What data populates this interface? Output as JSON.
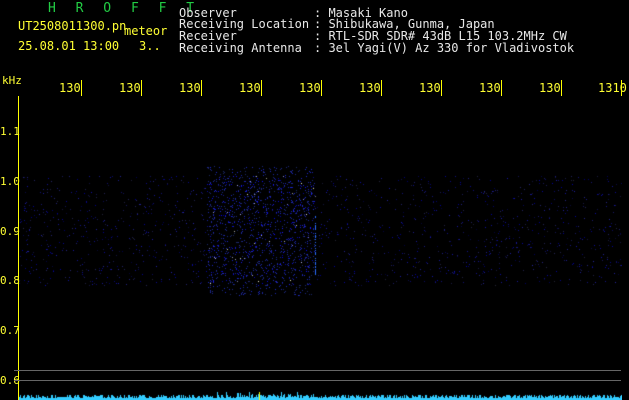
{
  "header": {
    "title": "H R O F F T",
    "file_name": "UT2508011300.pn",
    "meteor_label": "meteor",
    "datetime": "25.08.01 13:00",
    "count": "3.."
  },
  "info": [
    {
      "label": "Observer",
      "value": ": Masaki Kano"
    },
    {
      "label": "Receiving Location",
      "value": ": Shibukawa, Gunma, Japan"
    },
    {
      "label": "Receiver",
      "value": ": RTL-SDR SDR# 43dB L15 103.2MHz CW"
    },
    {
      "label": "Receiving Antenna",
      "value": ": 3el Yagi(V) Az 330 for Vladivostok"
    }
  ],
  "axis": {
    "y_unit": "kHz",
    "x_ticks": [
      "130",
      "130",
      "130",
      "130",
      "130",
      "130",
      "130",
      "130",
      "130",
      "1310"
    ],
    "y_ticks": [
      "1.1",
      "1.0",
      "0.9",
      "0.8",
      "0.7",
      "0.6"
    ]
  },
  "colors": {
    "background": "#000000",
    "text": "#ffff33",
    "title": "#22cc44",
    "signal": "#2244ff",
    "spectrum": "#33ccff"
  }
}
